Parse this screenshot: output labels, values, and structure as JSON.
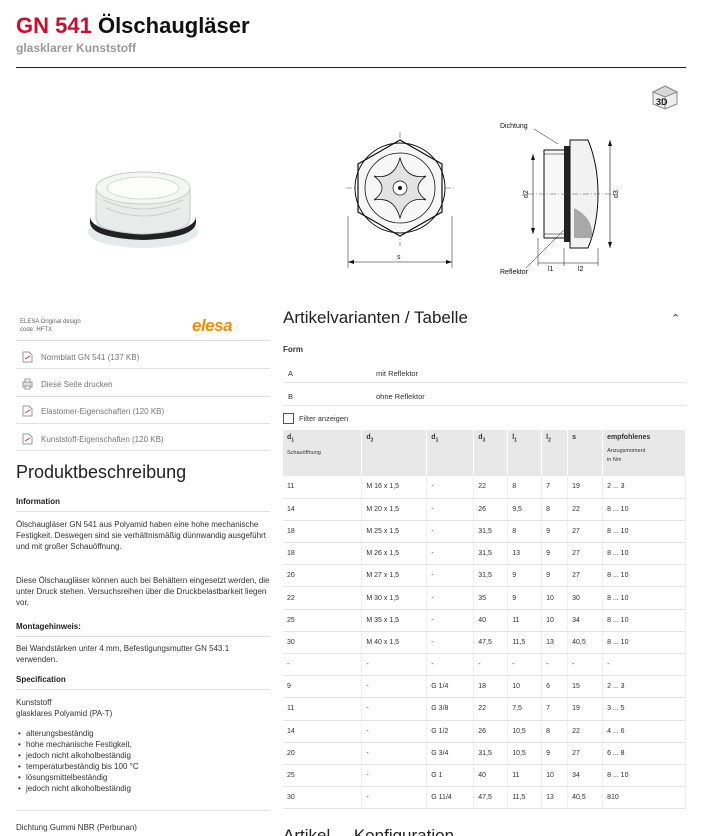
{
  "header": {
    "code": "GN 541",
    "name": "Ölschaugläser",
    "subtitle": "glasklarer Kunststoff"
  },
  "drawing": {
    "dichtung": "Dichtung",
    "reflektor": "Reflektor",
    "s": "s",
    "d2": "d2",
    "d3": "d3",
    "l1": "l1",
    "l2": "l2"
  },
  "cube_label": "3D",
  "sidebar": {
    "elesa_note1": "ELESA Original design",
    "elesa_note2": "code: HFTX",
    "logo": "elesa",
    "downloads": [
      "Normblatt GN 541 (137 KB)",
      "Diese Seite drucken",
      "Elastomer-Eigenschaften (120 KB)",
      "Kunststoff-Eigenschaften (120 KB)"
    ],
    "title": "Produktbeschreibung",
    "info_h": "Information",
    "info_p1": "Ölschaugläser GN 541 aus Polyamid haben eine hohe mechanische Festigkeit. Deswegen sind sie verhältnismäßig dünnwandig ausgeführt und mit großer Schauöffnung.",
    "info_p2": "Diese Ölschaugläser können auch bei Behältern eingesetzt werden, die unter Druck stehen. Versuchsreihen über die Druckbelastbarkeit liegen vor.",
    "mont_h": "Montagehinweis:",
    "mont_p": "Bei Wandstärken unter 4 mm, Befestigungsmutter GN 543.1 verwenden.",
    "spec_h": "Specification",
    "spec_l1": "Kunststoff",
    "spec_l2": "glasklares Polyamid (PA-T)",
    "bullets": [
      "alterungsbeständig",
      "hohe mechanische Festigkeit,",
      "jedoch nicht alkoholbeständig",
      "temperaturbeständig bis 100 °C",
      "lösungsmittelbeständig",
      "jedoch nicht alkoholbeständig"
    ],
    "dichtung": "Dichtung Gummi NBR (Perbunan)"
  },
  "main": {
    "title": "Artikelvarianten / Tabelle",
    "form_label": "Form",
    "forms": [
      {
        "key": "A",
        "val": "mit Reflektor"
      },
      {
        "key": "B",
        "val": "ohne Reflektor"
      }
    ],
    "filter": "Filter anzeigen",
    "headers": [
      {
        "t": "d",
        "s": "1",
        "sub": "Schauöffnung"
      },
      {
        "t": "d",
        "s": "2",
        "sub": ""
      },
      {
        "t": "d",
        "s": "1",
        "sub": ""
      },
      {
        "t": "d",
        "s": "3",
        "sub": ""
      },
      {
        "t": "l",
        "s": "1",
        "sub": ""
      },
      {
        "t": "l",
        "s": "2",
        "sub": ""
      },
      {
        "t": "s",
        "s": "",
        "sub": ""
      },
      {
        "t": "empfohlenes",
        "s": "",
        "sub": "Anzugsmoment\nin Nm"
      }
    ],
    "rows": [
      [
        "11",
        "M 16 x 1,5",
        "-",
        "22",
        "8",
        "7",
        "19",
        "2 ... 3"
      ],
      [
        "14",
        "M 20 x 1,5",
        "-",
        "26",
        "9,5",
        "8",
        "22",
        "8 ... 10"
      ],
      [
        "18",
        "M 25 x 1,5",
        "-",
        "31,5",
        "8",
        "9",
        "27",
        "8 ... 10"
      ],
      [
        "18",
        "M 26 x 1,5",
        "-",
        "31,5",
        "13",
        "9",
        "27",
        "8 ... 10"
      ],
      [
        "20",
        "M 27 x 1,5",
        "-",
        "31,5",
        "9",
        "9",
        "27",
        "8 ... 10"
      ],
      [
        "22",
        "M 30 x 1,5",
        "-",
        "35",
        "9",
        "10",
        "30",
        "8 ... 10"
      ],
      [
        "25",
        "M 35 x 1,5",
        "-",
        "40",
        "11",
        "10",
        "34",
        "8 ... 10"
      ],
      [
        "30",
        "M 40 x 1,5",
        "-",
        "47,5",
        "11,5",
        "13",
        "40,5",
        "8 ... 10"
      ],
      [
        "-",
        "-",
        "-",
        "-",
        "-",
        "-",
        "-",
        "-"
      ],
      [
        "9",
        "-",
        "G 1/4",
        "18",
        "10",
        "6",
        "15",
        "2 ... 3"
      ],
      [
        "11",
        "-",
        "G 3/8",
        "22",
        "7,5",
        "7",
        "19",
        "3 ... 5"
      ],
      [
        "14",
        "-",
        "G 1/2",
        "26",
        "10,5",
        "8",
        "22",
        "4 ... 6"
      ],
      [
        "20",
        "-",
        "G 3/4",
        "31,5",
        "10,5",
        "9",
        "27",
        "6 ... 8"
      ],
      [
        "25",
        "-",
        "G 1",
        "40",
        "11",
        "10",
        "34",
        "8 ... 10"
      ],
      [
        "30",
        "-",
        "G 11/4",
        "47,5",
        "11,5",
        "13",
        "40,5",
        "810"
      ]
    ],
    "next_title": "Artikel ... Konfiguration"
  }
}
